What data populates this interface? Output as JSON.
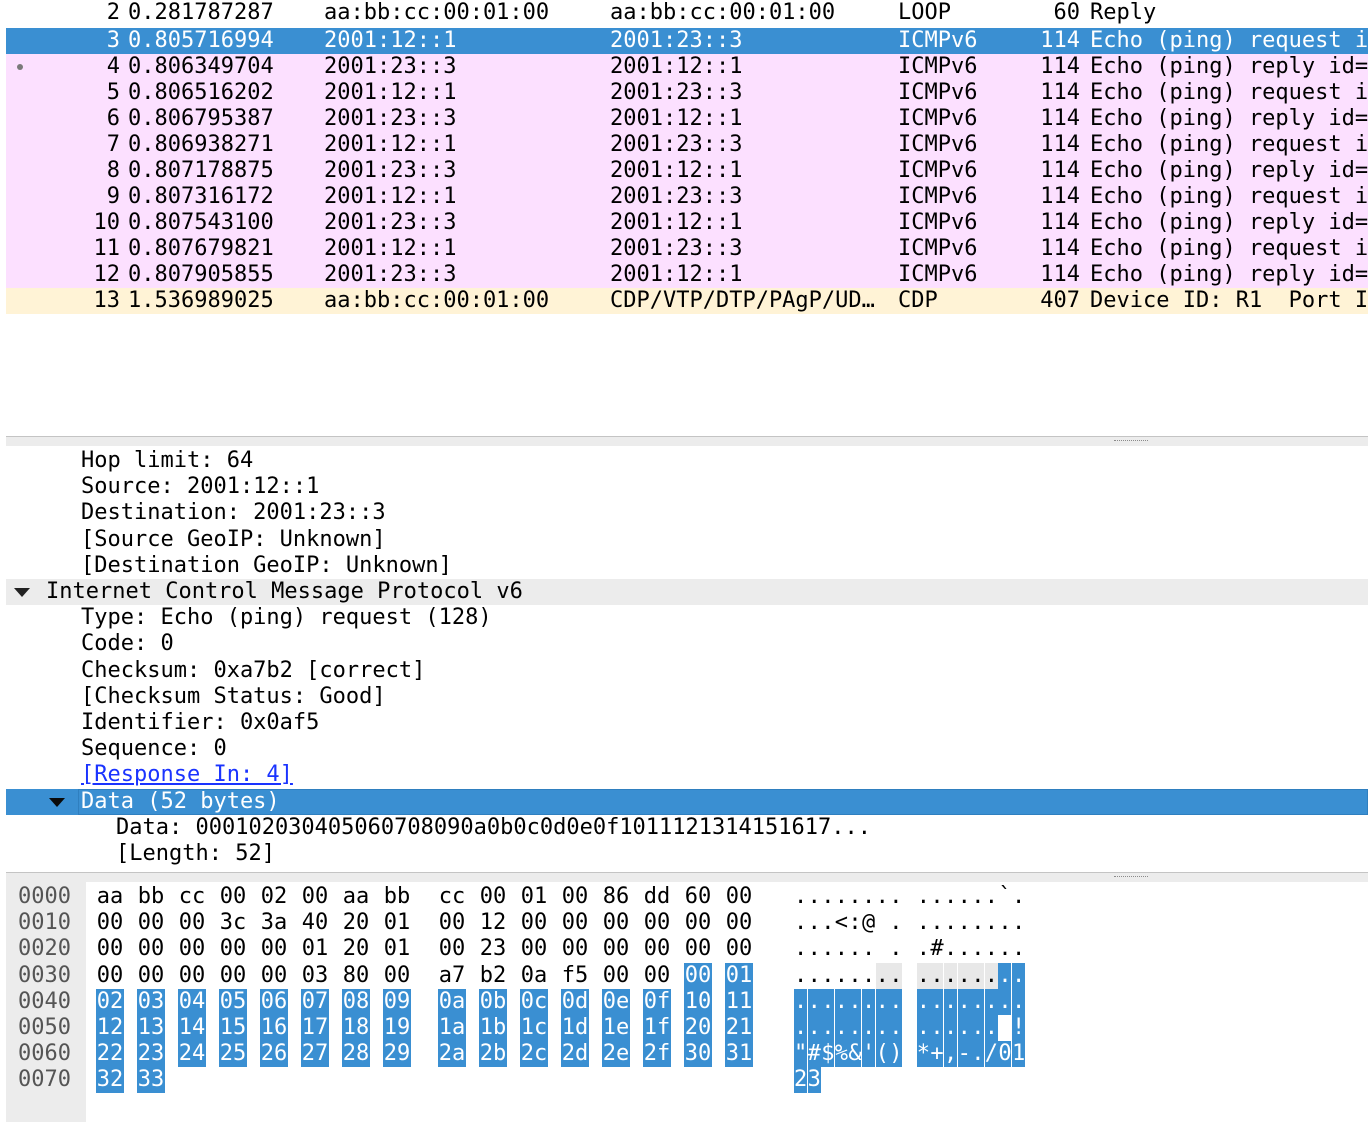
{
  "packet_list": {
    "rows": [
      {
        "no": "2",
        "time": "0.281787287",
        "src": "aa:bb:cc:00:01:00",
        "dst": "aa:bb:cc:00:01:00",
        "proto": "LOOP",
        "len": "60",
        "info": "Reply",
        "color": "other"
      },
      {
        "no": "3",
        "time": "0.805716994",
        "src": "2001:12::1",
        "dst": "2001:23::3",
        "proto": "ICMPv6",
        "len": "114",
        "info": "Echo (ping) request i",
        "color": "icmp",
        "selected": true
      },
      {
        "no": "4",
        "time": "0.806349704",
        "src": "2001:23::3",
        "dst": "2001:12::1",
        "proto": "ICMPv6",
        "len": "114",
        "info": "Echo (ping) reply id=",
        "color": "icmp",
        "marked": true
      },
      {
        "no": "5",
        "time": "0.806516202",
        "src": "2001:12::1",
        "dst": "2001:23::3",
        "proto": "ICMPv6",
        "len": "114",
        "info": "Echo (ping) request i",
        "color": "icmp"
      },
      {
        "no": "6",
        "time": "0.806795387",
        "src": "2001:23::3",
        "dst": "2001:12::1",
        "proto": "ICMPv6",
        "len": "114",
        "info": "Echo (ping) reply id=",
        "color": "icmp"
      },
      {
        "no": "7",
        "time": "0.806938271",
        "src": "2001:12::1",
        "dst": "2001:23::3",
        "proto": "ICMPv6",
        "len": "114",
        "info": "Echo (ping) request i",
        "color": "icmp"
      },
      {
        "no": "8",
        "time": "0.807178875",
        "src": "2001:23::3",
        "dst": "2001:12::1",
        "proto": "ICMPv6",
        "len": "114",
        "info": "Echo (ping) reply id=",
        "color": "icmp"
      },
      {
        "no": "9",
        "time": "0.807316172",
        "src": "2001:12::1",
        "dst": "2001:23::3",
        "proto": "ICMPv6",
        "len": "114",
        "info": "Echo (ping) request i",
        "color": "icmp"
      },
      {
        "no": "10",
        "time": "0.807543100",
        "src": "2001:23::3",
        "dst": "2001:12::1",
        "proto": "ICMPv6",
        "len": "114",
        "info": "Echo (ping) reply id=",
        "color": "icmp"
      },
      {
        "no": "11",
        "time": "0.807679821",
        "src": "2001:12::1",
        "dst": "2001:23::3",
        "proto": "ICMPv6",
        "len": "114",
        "info": "Echo (ping) request i",
        "color": "icmp"
      },
      {
        "no": "12",
        "time": "0.807905855",
        "src": "2001:23::3",
        "dst": "2001:12::1",
        "proto": "ICMPv6",
        "len": "114",
        "info": "Echo (ping) reply id=",
        "color": "icmp"
      },
      {
        "no": "13",
        "time": "1.536989025",
        "src": "aa:bb:cc:00:01:00",
        "dst": "CDP/VTP/DTP/PAgP/UD…",
        "proto": "CDP",
        "len": "407",
        "info": "Device ID: R1  Port I",
        "color": "cdp"
      }
    ]
  },
  "details": {
    "lines": [
      {
        "text": "Hop limit: 64",
        "indent": 2
      },
      {
        "text": "Source: 2001:12::1",
        "indent": 2
      },
      {
        "text": "Destination: 2001:23::3",
        "indent": 2
      },
      {
        "text": "[Source GeoIP: Unknown]",
        "indent": 2
      },
      {
        "text": "[Destination GeoIP: Unknown]",
        "indent": 2
      },
      {
        "text": "Internet Control Message Protocol v6",
        "indent": 1,
        "expander": true,
        "section": true
      },
      {
        "text": "Type: Echo (ping) request (128)",
        "indent": 2
      },
      {
        "text": "Code: 0",
        "indent": 2
      },
      {
        "text": "Checksum: 0xa7b2 [correct]",
        "indent": 2
      },
      {
        "text": "[Checksum Status: Good]",
        "indent": 2
      },
      {
        "text": "Identifier: 0x0af5",
        "indent": 2
      },
      {
        "text": "Sequence: 0",
        "indent": 2
      },
      {
        "text": "[Response In: 4]",
        "indent": 2,
        "link": true
      },
      {
        "text": "Data (52 bytes)",
        "indent": 2,
        "expander": true,
        "selected": true
      },
      {
        "text": "Data: 000102030405060708090a0b0c0d0e0f1011121314151617...",
        "indent": 3
      },
      {
        "text": "[Length: 52]",
        "indent": 3
      }
    ]
  },
  "bytes": {
    "rows": [
      {
        "offset": "0000",
        "hex": [
          "aa",
          "bb",
          "cc",
          "00",
          "02",
          "00",
          "aa",
          "bb",
          "cc",
          "00",
          "01",
          "00",
          "86",
          "dd",
          "60",
          "00"
        ],
        "ascii": "........ ......`."
      },
      {
        "offset": "0010",
        "hex": [
          "00",
          "00",
          "00",
          "3c",
          "3a",
          "40",
          "20",
          "01",
          "00",
          "12",
          "00",
          "00",
          "00",
          "00",
          "00",
          "00"
        ],
        "ascii": "...<:@ . ........"
      },
      {
        "offset": "0020",
        "hex": [
          "00",
          "00",
          "00",
          "00",
          "00",
          "01",
          "20",
          "01",
          "00",
          "23",
          "00",
          "00",
          "00",
          "00",
          "00",
          "00"
        ],
        "ascii": "...... . .#......"
      },
      {
        "offset": "0030",
        "hex": [
          "00",
          "00",
          "00",
          "00",
          "00",
          "03",
          "80",
          "00",
          "a7",
          "b2",
          "0a",
          "f5",
          "00",
          "00",
          "00",
          "01"
        ],
        "ascii": "........ ........"
      },
      {
        "offset": "0040",
        "hex": [
          "02",
          "03",
          "04",
          "05",
          "06",
          "07",
          "08",
          "09",
          "0a",
          "0b",
          "0c",
          "0d",
          "0e",
          "0f",
          "10",
          "11"
        ],
        "ascii": "........ ........"
      },
      {
        "offset": "0050",
        "hex": [
          "12",
          "13",
          "14",
          "15",
          "16",
          "17",
          "18",
          "19",
          "1a",
          "1b",
          "1c",
          "1d",
          "1e",
          "1f",
          "20",
          "21"
        ],
        "ascii": "........ ...... !"
      },
      {
        "offset": "0060",
        "hex": [
          "22",
          "23",
          "24",
          "25",
          "26",
          "27",
          "28",
          "29",
          "2a",
          "2b",
          "2c",
          "2d",
          "2e",
          "2f",
          "30",
          "31"
        ],
        "ascii": "\"#$%&'() *+,-./01"
      },
      {
        "offset": "0070",
        "hex": [
          "32",
          "33"
        ],
        "ascii": "23"
      }
    ],
    "highlight_start": 62,
    "highlight_end": 113
  },
  "colors": {
    "selected": "#3a8fd2",
    "icmp": "#fce0ff",
    "cdp": "#fff3d6",
    "link": "#1a33ff"
  }
}
